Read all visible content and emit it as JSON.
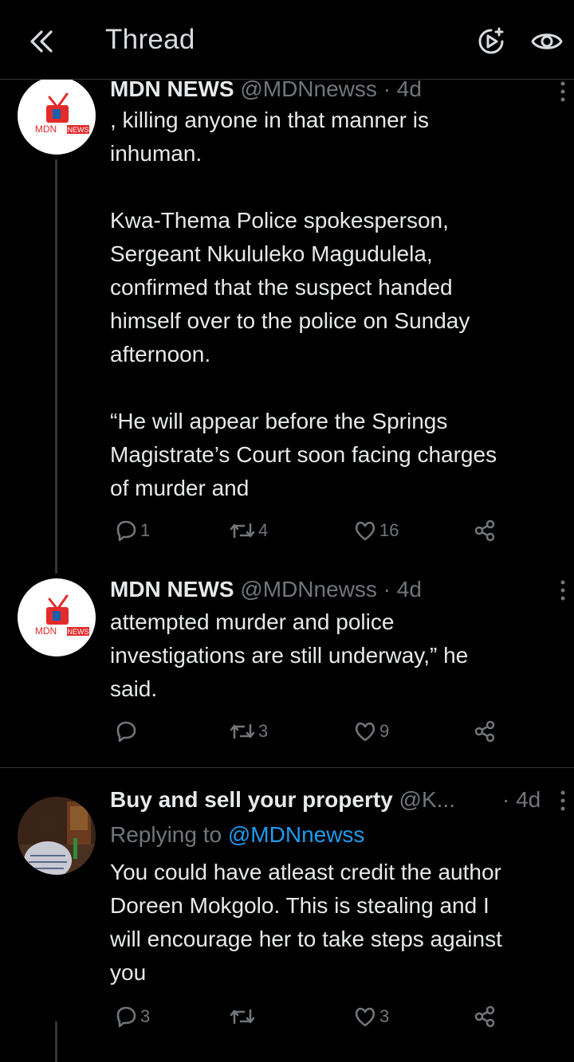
{
  "header": {
    "title": "Thread"
  },
  "tweets": [
    {
      "name": "MDN NEWS",
      "handle": "@MDNnewss · 4d",
      "avatar_label": "MDN NEWS",
      "lines": [
        ", killing anyone in that manner is",
        "inhuman.",
        "",
        "Kwa-Thema Police spokesperson,",
        "Sergeant Nkululeko Magudulela,",
        "confirmed that the suspect handed",
        "himself over to the police on Sunday",
        "afternoon.",
        "",
        "“He will appear before the Springs",
        "Magistrate’s Court soon facing charges",
        "of murder and"
      ],
      "replies": "1",
      "retweets": "4",
      "likes": "16"
    },
    {
      "name": "MDN NEWS",
      "handle": "@MDNnewss · 4d",
      "avatar_label": "MDN NEWS",
      "lines": [
        "attempted murder and police",
        "investigations are still underway,” he",
        "said."
      ],
      "replies": "",
      "retweets": "3",
      "likes": "9"
    },
    {
      "name": "Buy and sell your property",
      "handle": "@K...",
      "time": "· 4d",
      "replying_prefix": "Replying to",
      "replying_handle": "@MDNnewss",
      "lines": [
        "You could have atleast credit the author",
        "Doreen Mokgolo. This is stealing and I",
        "will encourage her to take steps against",
        "you"
      ],
      "replies": "3",
      "retweets": "",
      "likes": "3"
    }
  ],
  "colors": {
    "background": "#000000",
    "text": "#e7e9ea",
    "secondary": "#71767b",
    "link": "#1d9bf0",
    "divider": "#2f3336"
  }
}
